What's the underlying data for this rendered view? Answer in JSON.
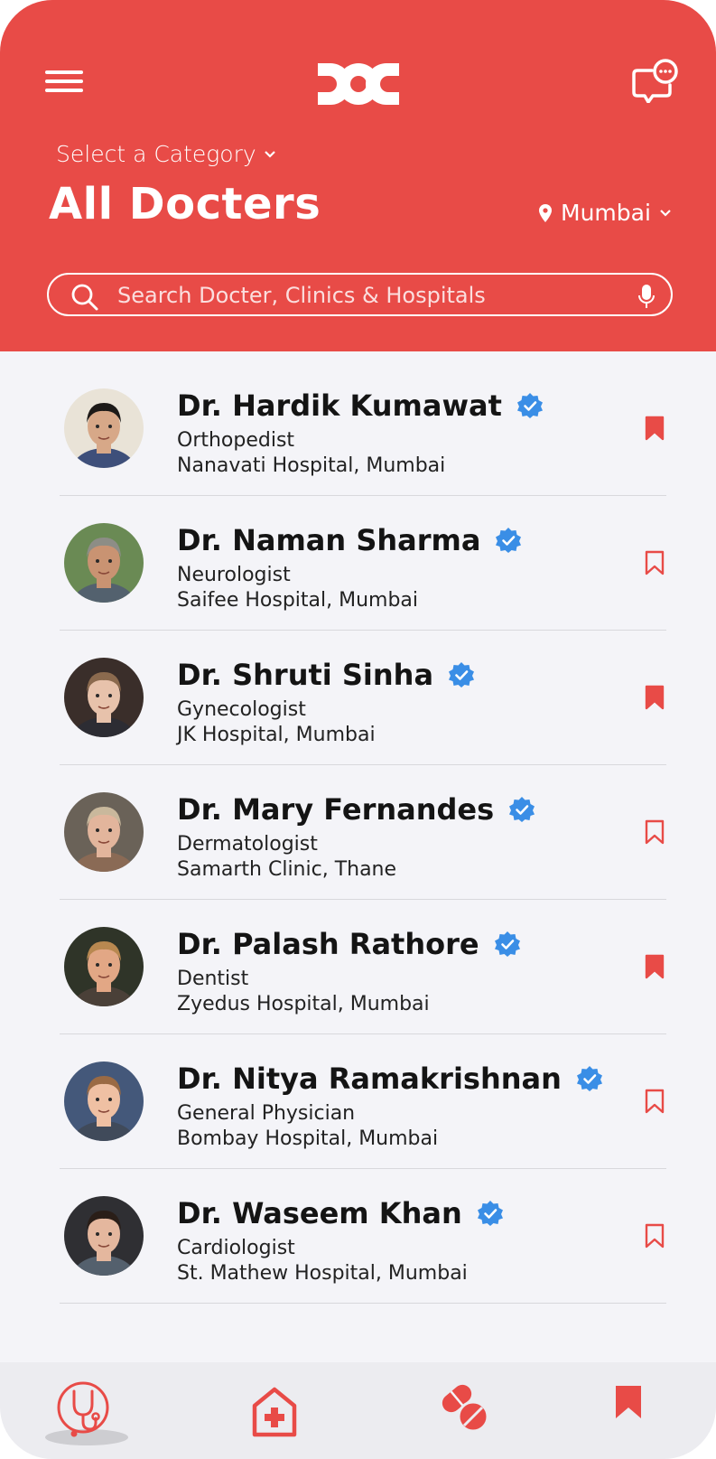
{
  "header": {
    "category_label": "Select a Category",
    "title": "All Docters",
    "location": "Mumbai",
    "search_placeholder": "Search Docter, Clinics & Hospitals"
  },
  "doctors": [
    {
      "name": "Dr. Hardik Kumawat",
      "speciality": "Orthopedist",
      "hospital": "Nanavati Hospital, Mumbai",
      "bookmarked": true
    },
    {
      "name": "Dr. Naman Sharma",
      "speciality": "Neurologist",
      "hospital": "Saifee Hospital, Mumbai",
      "bookmarked": false
    },
    {
      "name": "Dr. Shruti Sinha",
      "speciality": "Gynecologist",
      "hospital": "JK Hospital, Mumbai",
      "bookmarked": true
    },
    {
      "name": "Dr. Mary Fernandes",
      "speciality": "Dermatologist",
      "hospital": "Samarth Clinic, Thane",
      "bookmarked": false
    },
    {
      "name": "Dr. Palash Rathore",
      "speciality": "Dentist",
      "hospital": "Zyedus Hospital, Mumbai",
      "bookmarked": true
    },
    {
      "name": "Dr. Nitya Ramakrishnan",
      "speciality": "General Physician",
      "hospital": "Bombay Hospital, Mumbai",
      "bookmarked": false
    },
    {
      "name": "Dr. Waseem Khan",
      "speciality": "Cardiologist",
      "hospital": "St. Mathew Hospital, Mumbai",
      "bookmarked": false
    }
  ],
  "bottom_nav": [
    {
      "icon": "stethoscope-icon",
      "active": true
    },
    {
      "icon": "hospital-icon",
      "active": false
    },
    {
      "icon": "pills-icon",
      "active": false
    },
    {
      "icon": "bookmark-icon",
      "active": false
    }
  ],
  "colors": {
    "brand": "#e84b47",
    "verified": "#3a8ee6",
    "background": "#f4f4f8"
  }
}
